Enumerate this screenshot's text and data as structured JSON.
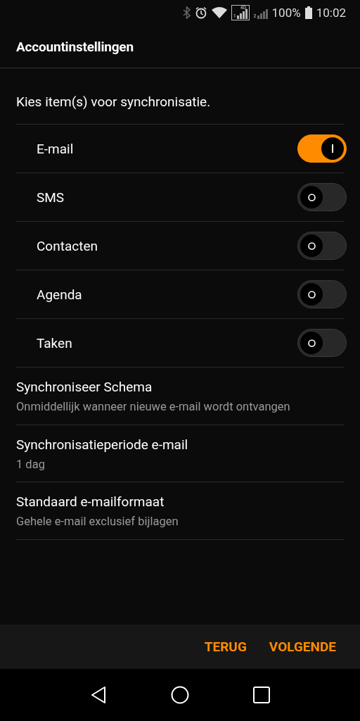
{
  "status_bar": {
    "network": "4G",
    "sim_1": "1",
    "sim_2": "2",
    "battery": "100%",
    "time": "10:02"
  },
  "title": "Accountinstellingen",
  "intro": "Kies item(s) voor synchronisatie.",
  "sync_items": [
    {
      "label": "E-mail",
      "on": true
    },
    {
      "label": "SMS",
      "on": false
    },
    {
      "label": "Contacten",
      "on": false
    },
    {
      "label": "Agenda",
      "on": false
    },
    {
      "label": "Taken",
      "on": false
    }
  ],
  "settings": [
    {
      "title": "Synchroniseer Schema",
      "value": "Onmiddellijk wanneer nieuwe e-mail wordt ontvangen"
    },
    {
      "title": "Synchronisatieperiode e-mail",
      "value": "1 dag"
    },
    {
      "title": "Standaard e-mailformaat",
      "value": "Gehele e-mail exclusief bijlagen"
    }
  ],
  "buttons": [
    "TERUG",
    "VOLGENDE"
  ]
}
